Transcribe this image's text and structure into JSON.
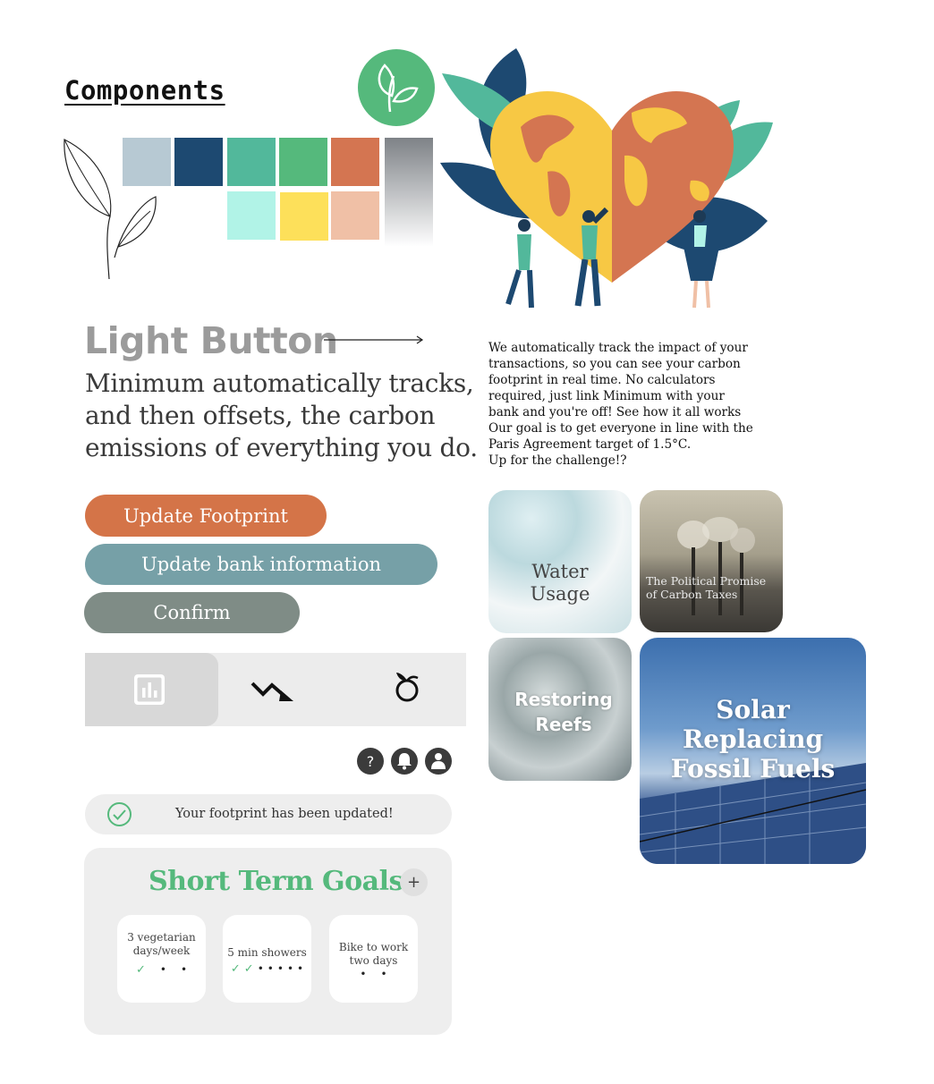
{
  "title": "Components",
  "palette": {
    "colors": [
      "#b7c9d3",
      "#1d4971",
      "#52b89b",
      "#55b97c",
      "#d47551",
      "#b1f3e7",
      "#fde05a",
      "#f0c0a6"
    ],
    "gradient": [
      "#7e8287",
      "#ffffff"
    ]
  },
  "illustration": {
    "name": "heart-shaped-earth-with-people"
  },
  "typography": {
    "heading": "Light Button",
    "body": "Minimum automatically tracks, and then offsets, the carbon emissions of everything you do."
  },
  "description": {
    "lines": [
      "We automatically track the impact of your",
      "transactions, so you can see your carbon",
      "footprint in real time. No calculators",
      "required, just link Minimum with your",
      "bank and you're off! See how it all works",
      "Our goal is to get everyone in line with the",
      "Paris Agreement target of 1.5°C.",
      "Up for the challenge!?"
    ]
  },
  "buttons": {
    "update_footprint": "Update Footprint",
    "update_bank": "Update bank information",
    "confirm": "Confirm"
  },
  "button_colors": {
    "primary": "#d47448",
    "secondary": "#76a0a7",
    "tertiary": "#7f8c86"
  },
  "tabs": [
    {
      "icon": "bar-chart-icon",
      "active": true
    },
    {
      "icon": "trend-down-icon",
      "active": false
    },
    {
      "icon": "fruit-icon",
      "active": false
    }
  ],
  "header_icons": {
    "help": "?",
    "notifications": "bell-icon",
    "profile": "user-icon"
  },
  "toast": {
    "message": "Your  footprint has been updated!",
    "icon": "check-circle-icon"
  },
  "goals": {
    "title": "Short Term Goals",
    "add_label": "+",
    "items": [
      {
        "lines": [
          "3 vegetarian",
          "days/week"
        ],
        "done": 1,
        "total": 3
      },
      {
        "lines": [
          "5 min showers"
        ],
        "done": 2,
        "total": 7
      },
      {
        "lines": [
          "Bike to work",
          "two days"
        ],
        "done": 0,
        "total": 2
      }
    ]
  },
  "tiles": {
    "water": "Water\nUsage",
    "carbon": "The Political Promise of Carbon Taxes",
    "reefs": "Restoring\nReefs",
    "solar": "Solar\nReplacing\nFossil Fuels"
  }
}
